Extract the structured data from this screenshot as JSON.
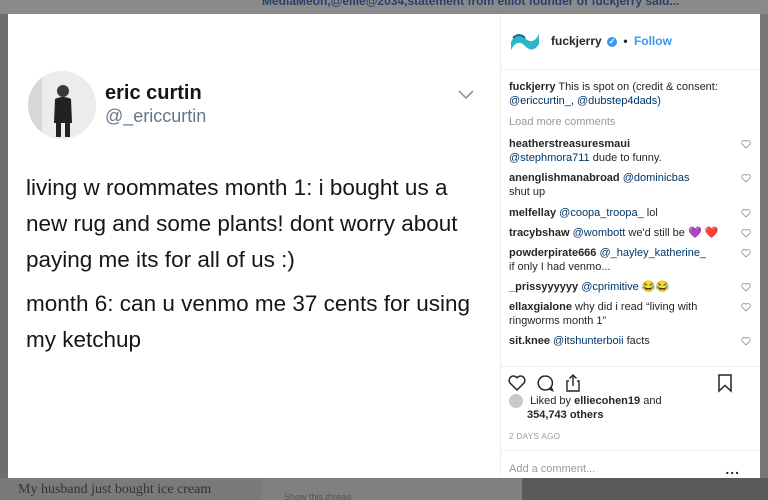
{
  "background": {
    "top_text": "MediaMeon,@ellie@2034,statement from elliot founder of fuckjerry said...",
    "bottom_left_text": "My husband just bought ice cream",
    "bottom_mid_text": "Show this thread"
  },
  "tweet": {
    "name": "eric curtin",
    "handle": "@_ericcurtin",
    "paragraph1": "living w roommates month 1: i bought us a new rug and some plants! dont worry about paying me its for all of us :)",
    "paragraph2": "month 6: can u venmo me 37 cents for using my ketchup"
  },
  "sidebar": {
    "username": "fuckjerry",
    "dot": "•",
    "follow_label": "Follow",
    "caption": {
      "user": "fuckjerry",
      "text": "This is spot on (credit & consent:",
      "mentions": "@ericcurtin_, @dubstep4dads)"
    },
    "load_more_label": "Load more comments",
    "comments": [
      {
        "user": "heatherstreasuresmaui",
        "mention": "@stephmora711",
        "text": "dude to funny."
      },
      {
        "user": "anenglishmanabroad",
        "mention": "@dominicbas",
        "text": "shut up"
      },
      {
        "user": "melfellay",
        "mention": "@coopa_troopa_",
        "text": "lol"
      },
      {
        "user": "tracybshaw",
        "mention": "@wombott",
        "text": "we'd still be 💜 ❤️"
      },
      {
        "user": "powderpirate666",
        "mention": "@_hayley_katherine_",
        "text": "if only I had venmo..."
      },
      {
        "user": "_prissyyyyyy",
        "mention": "@cprimitive",
        "text": "😂😂"
      },
      {
        "user": "ellaxgialone",
        "mention": "",
        "text": "why did i read “living with ringworms month 1”"
      },
      {
        "user": "sit.knee",
        "mention": "@itshunterboii",
        "text": "facts"
      }
    ],
    "likes": {
      "prefix": "Liked by",
      "user": "elliecohen19",
      "and": "and",
      "others": "354,743 others"
    },
    "date": "2 DAYS AGO",
    "add_comment_placeholder": "Add a comment...",
    "more_label": "..."
  },
  "colors": {
    "accent": "#3897f0",
    "mention": "#003569",
    "muted": "#999999"
  }
}
